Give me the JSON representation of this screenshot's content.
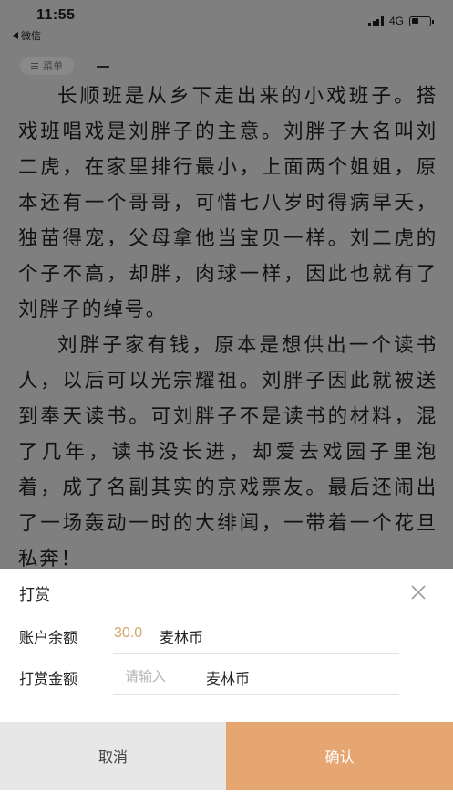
{
  "status_bar": {
    "time": "11:55",
    "back_label": "微信",
    "network": "4G"
  },
  "reader": {
    "menu_label": "菜单",
    "paragraphs": [
      "长顺班是从乡下走出来的小戏班子。搭戏班唱戏是刘胖子的主意。刘胖子大名叫刘二虎，在家里排行最小，上面两个姐姐，原本还有一个哥哥，可惜七八岁时得病早夭，独苗得宠，父母拿他当宝贝一样。刘二虎的个子不高，却胖，肉球一样，因此也就有了刘胖子的绰号。",
      "刘胖子家有钱，原本是想供出一个读书人，以后可以光宗耀祖。刘胖子因此就被送到奉天读书。可刘胖子不是读书的材料，混了几年，读书没长进，却爱去戏园子里泡着，成了名副其实的京戏票友。最后还闹出了一场轰动一时的大绯闻，一带着一个花旦私奔！"
    ]
  },
  "reward_sheet": {
    "title": "打赏",
    "balance_label": "账户余额",
    "balance_value": "30.0",
    "balance_unit": "麦林币",
    "amount_label": "打赏金额",
    "amount_placeholder": "请输入",
    "amount_value": "",
    "amount_unit": "麦林币",
    "cancel_label": "取消",
    "confirm_label": "确认"
  },
  "colors": {
    "overlay_gray": "#7f7f7f",
    "accent_gold": "#d3a46c",
    "confirm_orange": "#e6a672",
    "cancel_gray": "#e7e7e7"
  }
}
